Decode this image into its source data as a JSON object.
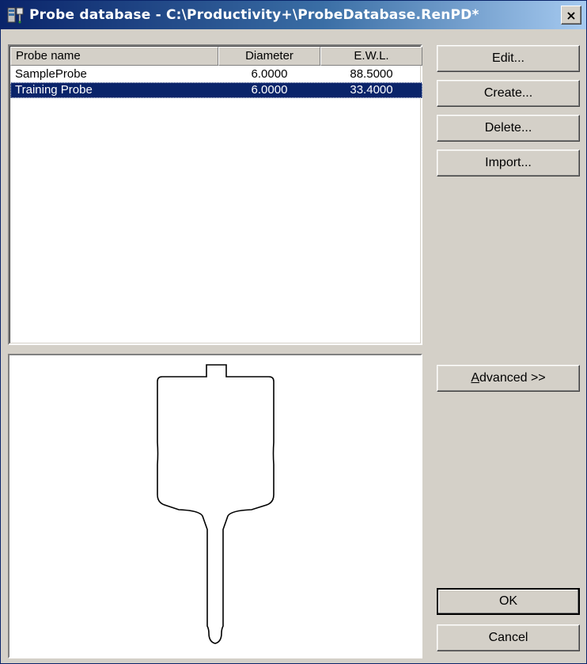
{
  "window": {
    "title": "Probe database - C:\\Productivity+\\ProbeDatabase.RenPD*",
    "close_label": "×"
  },
  "list": {
    "columns": [
      "Probe name",
      "Diameter",
      "E.W.L."
    ],
    "rows": [
      {
        "name": "SampleProbe",
        "diameter": "6.0000",
        "ewl": "88.5000",
        "selected": false
      },
      {
        "name": "Training Probe",
        "diameter": "6.0000",
        "ewl": "33.4000",
        "selected": true
      }
    ]
  },
  "buttons": {
    "edit": "Edit...",
    "create": "Create...",
    "delete": "Delete...",
    "import": "Import...",
    "advanced_mnemonic": "A",
    "advanced_rest": "dvanced >>",
    "ok": "OK",
    "cancel": "Cancel"
  },
  "colors": {
    "selection": "#0a246a",
    "face": "#d4d0c8"
  }
}
